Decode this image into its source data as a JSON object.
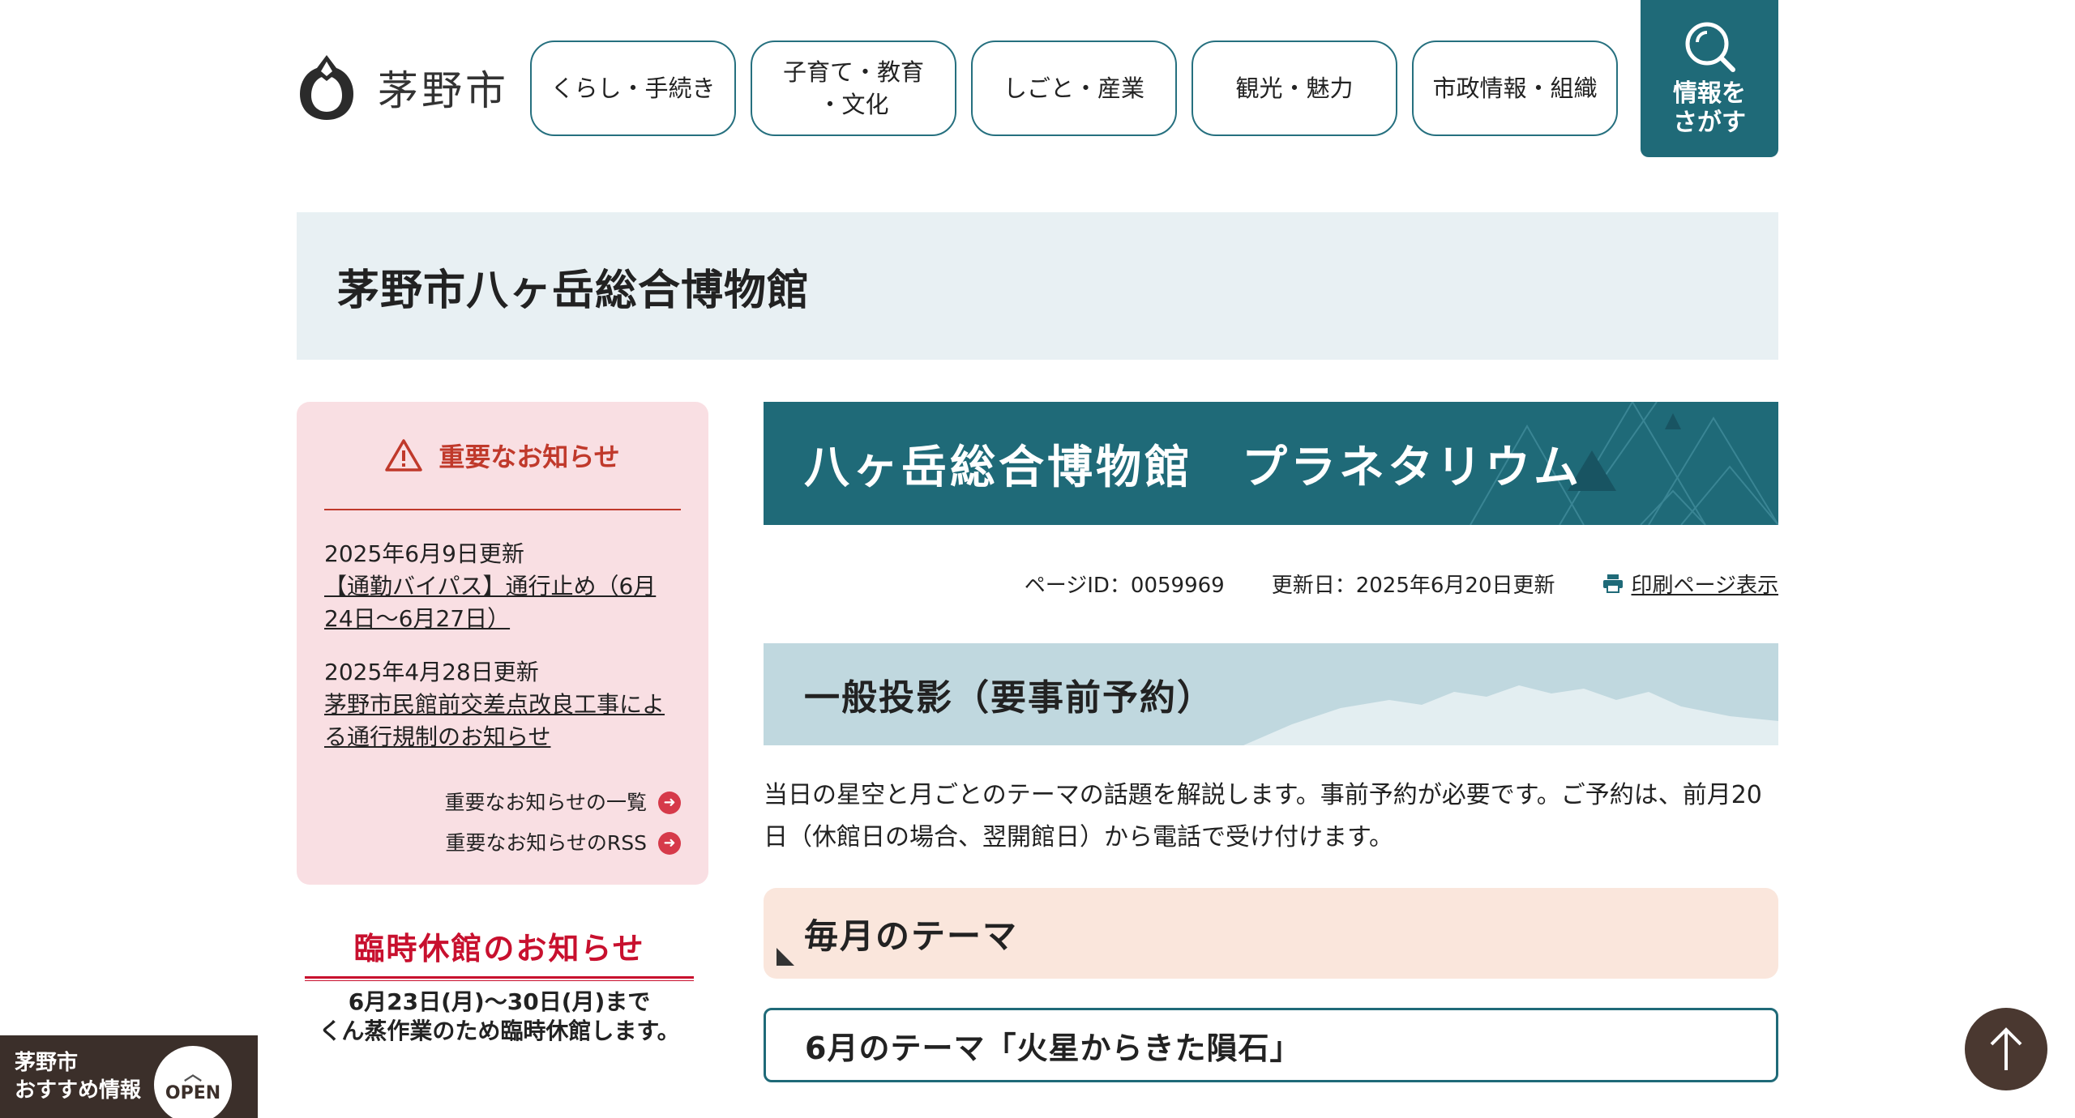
{
  "header": {
    "logo_text": "茅野市",
    "nav": [
      {
        "label": "くらし・手続き"
      },
      {
        "label": "子育て・教育\n・文化"
      },
      {
        "label": "しごと・産業"
      },
      {
        "label": "観光・魅力"
      },
      {
        "label": "市政情報・組織"
      }
    ],
    "search_label": "情報を\nさがす"
  },
  "page_title": "茅野市八ヶ岳総合博物館",
  "sidebar": {
    "notice_title": "重要なお知らせ",
    "items": [
      {
        "date": "2025年6月9日更新",
        "link": "【通勤バイパス】通行止め（6月24日～6月27日）"
      },
      {
        "date": "2025年4月28日更新",
        "link": "茅野市民館前交差点改良工事による通行規制のお知らせ"
      }
    ],
    "footer_links": [
      {
        "label": "重要なお知らせの一覧"
      },
      {
        "label": "重要なお知らせのRSS"
      }
    ],
    "closure": {
      "title": "臨時休館のお知らせ",
      "text": "6月23日(月)～30日(月)まで\nくん蒸作業のため臨時休館します。"
    }
  },
  "main": {
    "hero_title": "八ヶ岳総合博物館　プラネタリウム",
    "page_id": "ページID：0059969",
    "updated": "更新日：2025年6月20日更新",
    "print_label": "印刷ページ表示",
    "section_title": "一般投影（要事前予約）",
    "lead": "当日の星空と月ごとのテーマの話題を解説します。事前予約が必要です。ご予約は、前月20日（休館日の場合、翌開館日）から電話で受け付けます。",
    "sub_title": "毎月のテーマ",
    "theme_title": "6月のテーマ「火星からきた隕石」"
  },
  "floating": {
    "osusume_label": "茅野市\nおすすめ情報",
    "open_label": "OPEN"
  },
  "colors": {
    "primary": "#1f6a78",
    "notice_bg": "#f9dfe3",
    "notice_accent": "#c0392b",
    "title_band_bg": "#e8f0f3",
    "section_bg": "#c0d8df",
    "sub_bg": "#fae6dc",
    "float_bg": "#3b2f2a"
  },
  "icons": {
    "logo": "city-emblem-icon",
    "search": "search-icon",
    "notice": "warning-icon",
    "print": "printer-icon",
    "link_arrow": "arrow-right-circle-icon",
    "page_top": "arrow-up-icon",
    "open": "chevron-up-icon"
  }
}
